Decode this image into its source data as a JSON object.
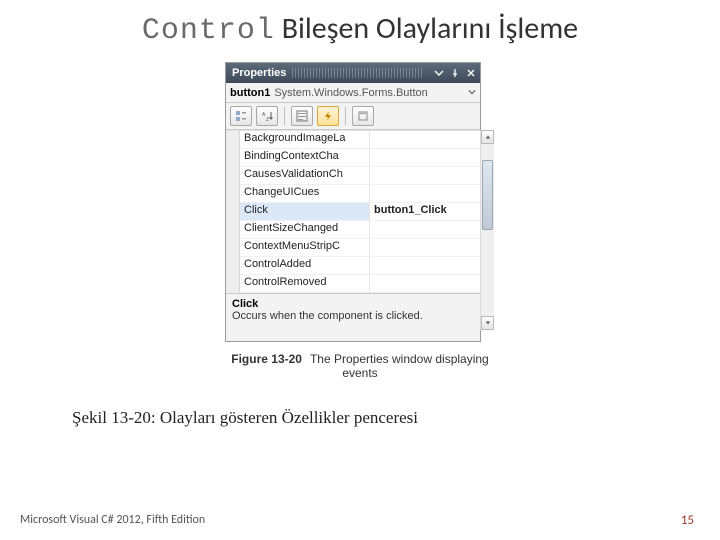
{
  "title": {
    "code": "Control",
    "rest": " Bileşen Olaylarını İşleme"
  },
  "properties_window": {
    "title": "Properties",
    "object_name": "button1",
    "object_type": "System.Windows.Forms.Button",
    "rows": [
      {
        "name": "BackgroundImageLa",
        "value": ""
      },
      {
        "name": "BindingContextCha",
        "value": ""
      },
      {
        "name": "CausesValidationCh",
        "value": ""
      },
      {
        "name": "ChangeUICues",
        "value": ""
      },
      {
        "name": "Click",
        "value": "button1_Click",
        "selected": true
      },
      {
        "name": "ClientSizeChanged",
        "value": ""
      },
      {
        "name": "ContextMenuStripC",
        "value": ""
      },
      {
        "name": "ControlAdded",
        "value": ""
      },
      {
        "name": "ControlRemoved",
        "value": ""
      }
    ],
    "description_title": "Click",
    "description_text": "Occurs when the component is clicked."
  },
  "figure_caption": {
    "num": "Figure 13-20",
    "text": "The Properties window displaying events"
  },
  "sekil_text": "Şekil 13-20: Olayları gösteren Özellikler penceresi",
  "footer": {
    "left": "Microsoft Visual C# 2012, Fifth Edition",
    "right": "15"
  }
}
